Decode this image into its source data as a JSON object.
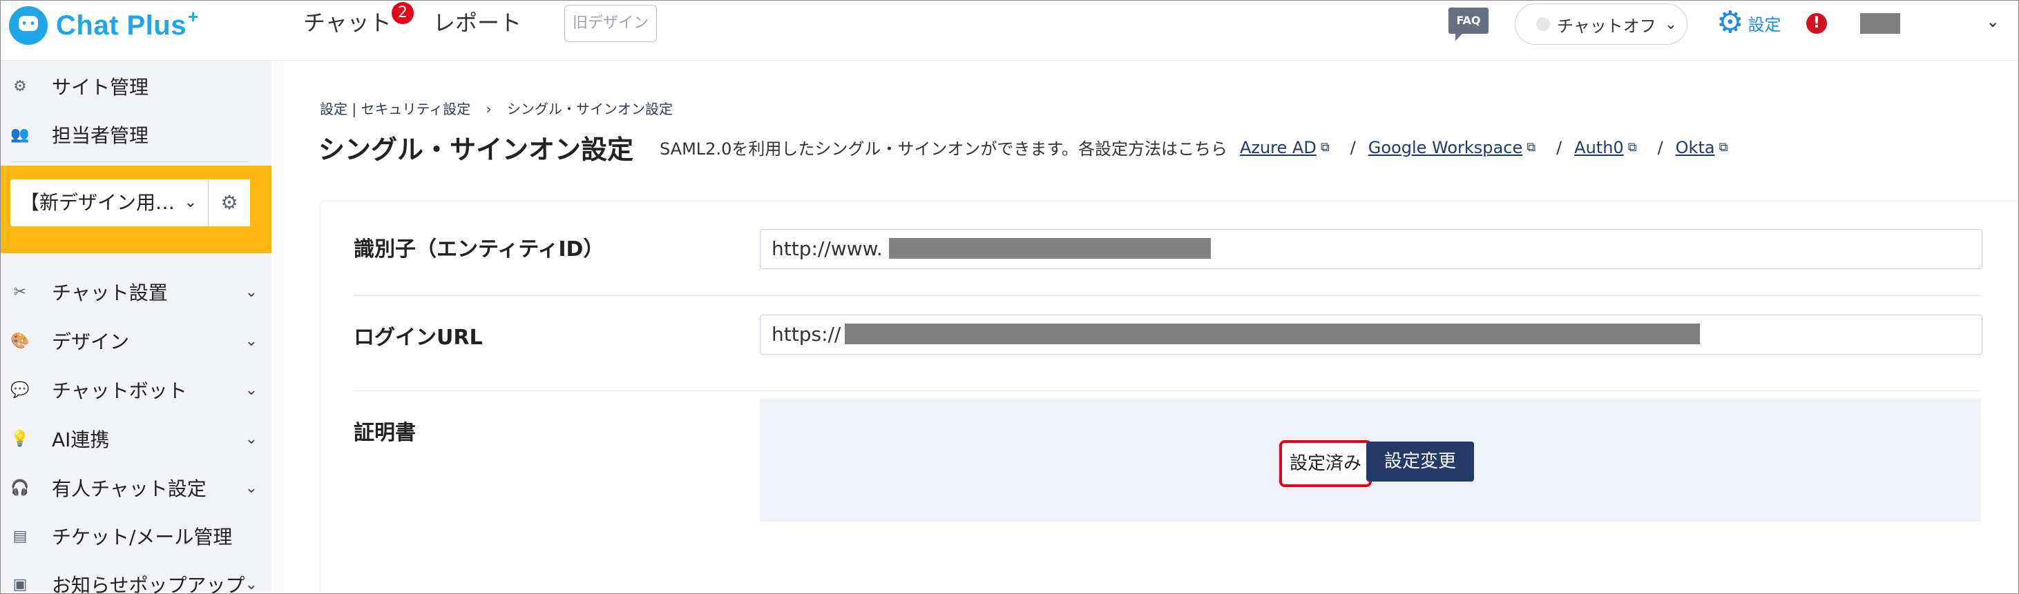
{
  "header": {
    "logo_text": "Chat Plus",
    "logo_plus": "+",
    "nav": {
      "chat": "チャット",
      "chat_badge": "2",
      "report": "レポート",
      "old_design": "旧デザイン"
    },
    "faq": "FAQ",
    "chat_status": "チャットオフ",
    "settings": "設定",
    "alert": "!"
  },
  "sidebar": {
    "top_items": [
      {
        "label": "サイト管理",
        "icon": "gear-icon"
      },
      {
        "label": "担当者管理",
        "icon": "people-icon"
      }
    ],
    "site_select": "【新デザイン用…",
    "items": [
      {
        "label": "チャット設置",
        "icon": "tools-icon"
      },
      {
        "label": "デザイン",
        "icon": "palette-icon"
      },
      {
        "label": "チャットボット",
        "icon": "chat-bubble-icon"
      },
      {
        "label": "AI連携",
        "icon": "bulb-icon"
      },
      {
        "label": "有人チャット設定",
        "icon": "headset-icon"
      },
      {
        "label": "チケット/メール管理",
        "icon": "list-icon"
      },
      {
        "label": "お知らせポップアップ",
        "icon": "popup-icon"
      }
    ]
  },
  "main": {
    "breadcrumb": {
      "part1": "設定 | セキュリティ設定",
      "arrow": "›",
      "part2": "シングル・サインオン設定"
    },
    "title": "シングル・サインオン設定",
    "description": "SAML2.0を利用したシングル・サインオンができます。各設定方法はこちら",
    "links": [
      "Azure AD",
      "Google Workspace",
      "Auth0",
      "Okta"
    ],
    "link_separator": "/",
    "form": {
      "entity_id": {
        "label": "識別子（エンティティID）",
        "value": "http://www."
      },
      "login_url": {
        "label": "ログインURL",
        "value": "https://"
      },
      "certificate": {
        "label": "証明書",
        "status": "設定済み",
        "change_button": "設定変更"
      }
    }
  }
}
